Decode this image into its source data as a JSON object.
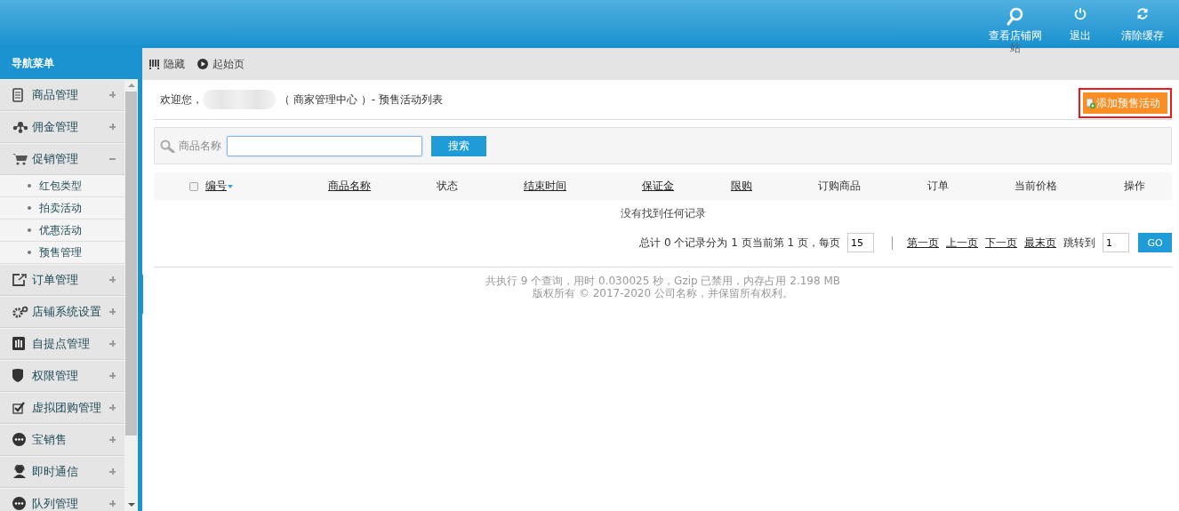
{
  "header": {
    "tools": [
      {
        "label": "查看店铺网站"
      },
      {
        "label": "退出"
      },
      {
        "label": "清除缓存"
      }
    ]
  },
  "sidebar": {
    "title": "导航菜单",
    "items": [
      {
        "label": "商品管理",
        "expanded": false
      },
      {
        "label": "佣金管理",
        "expanded": false
      },
      {
        "label": "促销管理",
        "expanded": true,
        "children": [
          {
            "label": "红包类型"
          },
          {
            "label": "拍卖活动"
          },
          {
            "label": "优惠活动"
          },
          {
            "label": "预售管理"
          }
        ]
      },
      {
        "label": "订单管理",
        "expanded": false
      },
      {
        "label": "店铺系统设置",
        "expanded": false
      },
      {
        "label": "自提点管理",
        "expanded": false
      },
      {
        "label": "权限管理",
        "expanded": false
      },
      {
        "label": "虚拟团购管理",
        "expanded": false
      },
      {
        "label": "宝销售",
        "expanded": false
      },
      {
        "label": "即时通信",
        "expanded": false
      },
      {
        "label": "队列管理",
        "expanded": false
      }
    ]
  },
  "toolbar": {
    "items": [
      {
        "label": "隐藏"
      },
      {
        "label": "起始页"
      }
    ]
  },
  "page": {
    "welcome": "欢迎您，",
    "title": "（ 商家管理中心 ）- 预售活动列表",
    "add_button": "添加预售活动"
  },
  "search": {
    "label": "商品名称",
    "button": "搜索"
  },
  "table": {
    "select_all": {
      "checked": false
    },
    "columns": [
      {
        "label": "编号",
        "link": true,
        "sorted": true
      },
      {
        "label": "商品名称",
        "link": true,
        "sorted": false
      },
      {
        "label": "状态",
        "link": false,
        "sorted": false
      },
      {
        "label": "结束时间",
        "link": true,
        "sorted": false
      },
      {
        "label": "保证金",
        "link": true,
        "sorted": false
      },
      {
        "label": "限购",
        "link": true,
        "sorted": false
      },
      {
        "label": "订购商品",
        "link": false,
        "sorted": false
      },
      {
        "label": "订单",
        "link": false,
        "sorted": false
      },
      {
        "label": "当前价格",
        "link": false,
        "sorted": false
      },
      {
        "label": "操作",
        "link": false,
        "sorted": false
      }
    ],
    "empty": "没有找到任何记录"
  },
  "pagination": {
    "summary": "总计 0 个记录分为 1 页当前第 1 页，每页",
    "per_page": "15",
    "links": [
      {
        "label": "第一页"
      },
      {
        "label": "上一页"
      },
      {
        "label": "下一页"
      },
      {
        "label": "最末页"
      }
    ],
    "jump_label": "跳转到",
    "jump_value": "1",
    "go": "GO"
  },
  "footer": {
    "lines": [
      "共执行 9 个查询，用时 0.030025 秒，Gzip 已禁用，内存占用 2.198 MB",
      "版权所有 © 2017-2020 公司名称，并保留所有权利。"
    ]
  }
}
